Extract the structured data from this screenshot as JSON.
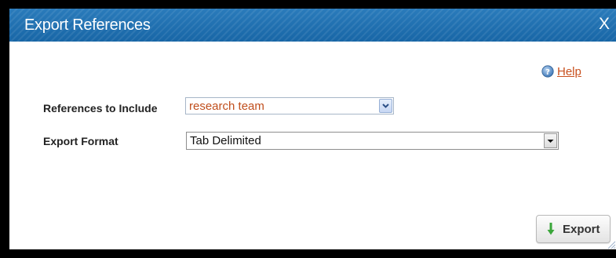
{
  "dialog": {
    "title": "Export References",
    "close_label": "X",
    "help_label": "Help"
  },
  "form": {
    "references_label": "References to Include",
    "references_value": "research team",
    "format_label": "Export Format",
    "format_value": "Tab Delimited"
  },
  "actions": {
    "export_label": "Export"
  },
  "icons": {
    "help": "help-question-icon",
    "export": "down-arrow-icon",
    "dropdown": "chevron-down-icon",
    "resize": "resize-grip-icon"
  },
  "colors": {
    "titlebar": "#1f6fae",
    "link": "#c8501e",
    "selected_value": "#c04e1c",
    "export_arrow": "#3aa63a"
  }
}
